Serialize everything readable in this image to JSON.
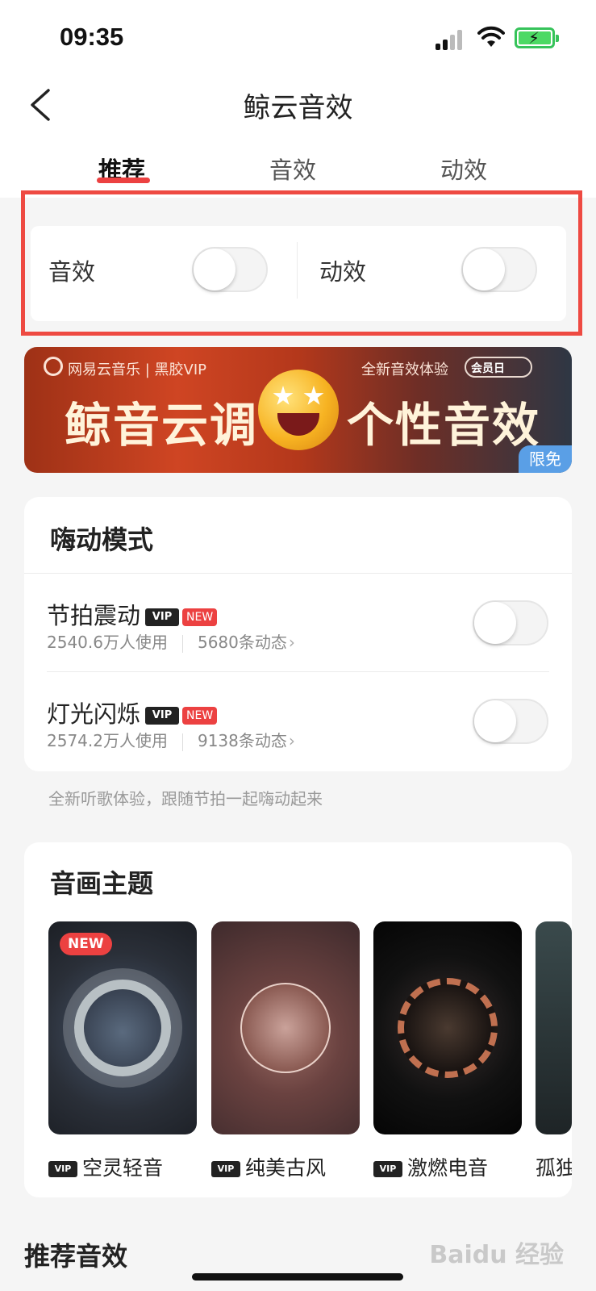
{
  "status": {
    "time": "09:35"
  },
  "header": {
    "title": "鲸云音效"
  },
  "tabs": [
    {
      "label": "推荐",
      "active": true
    },
    {
      "label": "音效",
      "active": false
    },
    {
      "label": "动效",
      "active": false
    }
  ],
  "switches": {
    "sound_label": "音效",
    "sound_on": false,
    "motion_label": "动效",
    "motion_on": false
  },
  "banner": {
    "brand": "网易云音乐 | 黑胶VIP",
    "subtitle": "全新音效体验",
    "badge": "会员日",
    "headline_left": "鲸音云调",
    "headline_right": "个性音效",
    "tag": "限免"
  },
  "hype_mode": {
    "title": "嗨动模式",
    "items": [
      {
        "name": "节拍震动",
        "vip": "VIP",
        "new": "NEW",
        "users": "2540.6万人使用",
        "posts": "5680条动态",
        "on": false
      },
      {
        "name": "灯光闪烁",
        "vip": "VIP",
        "new": "NEW",
        "users": "2574.2万人使用",
        "posts": "9138条动态",
        "on": false
      }
    ],
    "note": "全新听歌体验，跟随节拍一起嗨动起来"
  },
  "themes": {
    "title": "音画主题",
    "new_badge": "NEW",
    "items": [
      {
        "name": "空灵轻音",
        "vip": "VIP"
      },
      {
        "name": "纯美古风",
        "vip": "VIP"
      },
      {
        "name": "激燃电音",
        "vip": "VIP"
      },
      {
        "name": "孤独"
      }
    ]
  },
  "recommended": {
    "title": "推荐音效"
  },
  "watermark": "Baidu 经验",
  "colors": {
    "accent": "#ec4141",
    "highlight_box": "#ee4a42",
    "free_tag": "#5a9fe6"
  }
}
